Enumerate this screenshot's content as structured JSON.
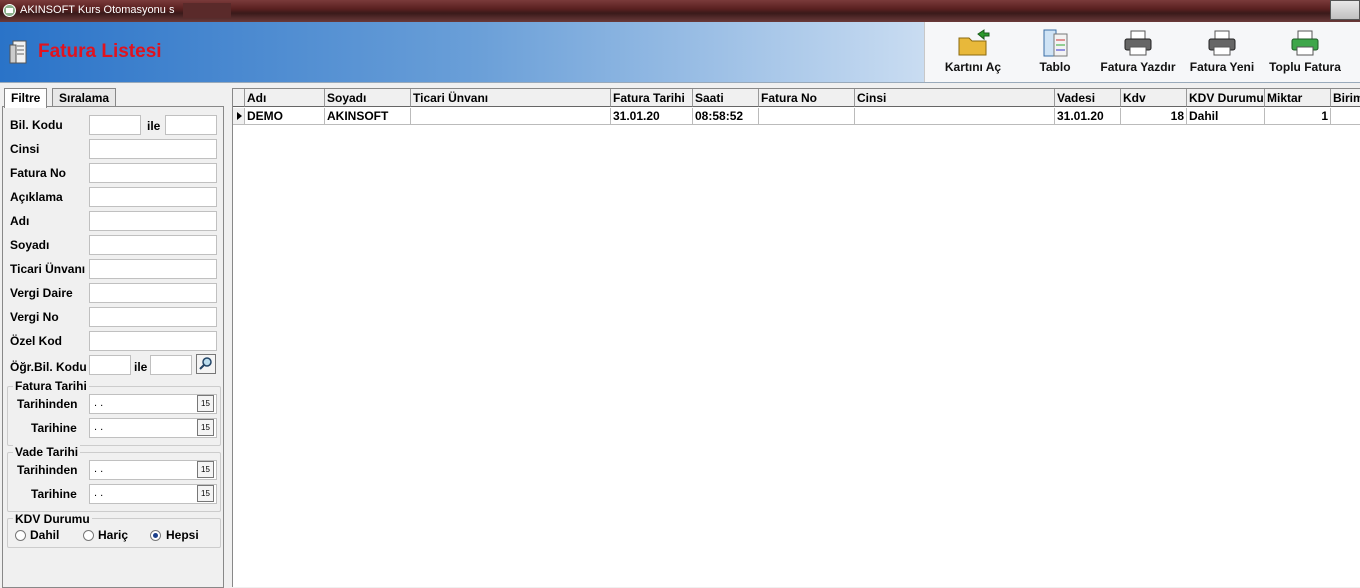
{
  "window": {
    "title": "AKINSOFT Kurs Otomasyonu s"
  },
  "header": {
    "page_title": "Fatura Listesi"
  },
  "toolbar": {
    "open_card": "Kartını Aç",
    "table": "Tablo",
    "print_invoice": "Fatura Yazdır",
    "new_invoice": "Fatura Yeni",
    "bulk_invoice": "Toplu Fatura"
  },
  "tabs": {
    "filter": "Filtre",
    "sort": "Sıralama"
  },
  "filter": {
    "code": "Bil. Kodu",
    "and1": "ile",
    "type": "Cinsi",
    "invoice_no": "Fatura No",
    "description": "Açıklama",
    "name": "Adı",
    "surname": "Soyadı",
    "company": "Ticari Ünvanı",
    "tax_office": "Vergi Daire",
    "tax_no": "Vergi No",
    "special_code": "Özel Kod",
    "student_code": "Öğr.Bil. Kodu",
    "and2": "ile",
    "invoice_date_group": "Fatura Tarihi",
    "from": "Tarihinden",
    "to": "Tarihine",
    "due_date_group": "Vade Tarihi",
    "from2": "Tarihinden",
    "to2": "Tarihine",
    "date_placeholder": ". .",
    "vat_group": "KDV Durumu",
    "vat_included": "Dahil",
    "vat_excluded": "Hariç",
    "vat_all": "Hepsi",
    "vat_selected": "Hepsi"
  },
  "grid": {
    "columns": [
      "Adı",
      "Soyadı",
      "Ticari Ünvanı",
      "Fatura Tarihi",
      "Saati",
      "Fatura No",
      "Cinsi",
      "Vadesi",
      "Kdv",
      "KDV Durumu",
      "Miktar",
      "Birim"
    ],
    "rows": [
      {
        "name": "DEMO",
        "surname": "AKINSOFT",
        "company": "",
        "date": "31.01.20",
        "time": "08:58:52",
        "invoice_no": "",
        "type": "",
        "due": "31.01.20",
        "kdv": "18",
        "kdv_status": "Dahil",
        "qty": "1",
        "unit": ""
      }
    ]
  }
}
